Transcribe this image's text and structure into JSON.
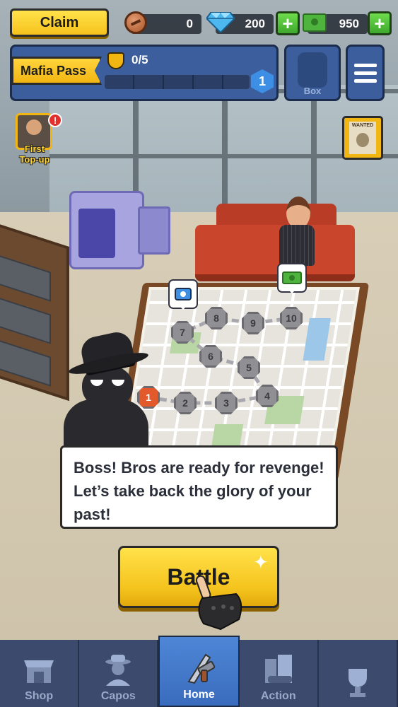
{
  "hud": {
    "claim_label": "Claim",
    "coins": "0",
    "gems": "200",
    "cash": "950"
  },
  "mafia_pass": {
    "title": "Mafia Pass",
    "progress_text": "0/5",
    "progress_fraction": 0,
    "level": "1"
  },
  "box": {
    "label": "Box"
  },
  "first_topup": {
    "label_line1": "First",
    "label_line2": "Top-up",
    "alert": "!"
  },
  "wanted": {
    "label": "WANTED"
  },
  "map": {
    "nodes": [
      "1",
      "2",
      "3",
      "4",
      "5",
      "6",
      "7",
      "8",
      "9",
      "10"
    ],
    "active_node": "1"
  },
  "dialog": {
    "text": "Boss! Bros are ready for revenge! Let’s take back the glory of your past!"
  },
  "battle": {
    "label": "Battle"
  },
  "nav": {
    "tabs": [
      {
        "label": "Shop"
      },
      {
        "label": "Capos"
      },
      {
        "label": "Home"
      },
      {
        "label": "Action"
      },
      {
        "label": ""
      }
    ]
  },
  "colors": {
    "gold": "#f5c31d",
    "panel_blue": "#3d5e9c",
    "nav_bg": "#3b4a6d",
    "active_node": "#e25a2b"
  }
}
